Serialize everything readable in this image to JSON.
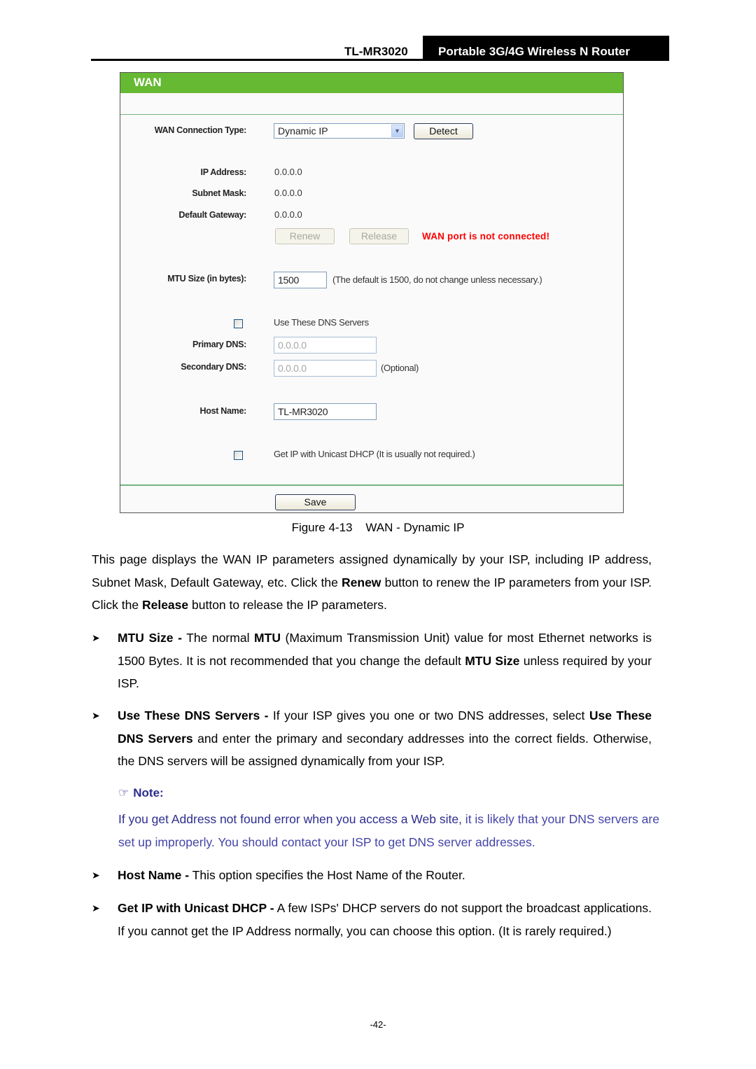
{
  "header": {
    "model": "TL-MR3020",
    "product": "Portable 3G/4G Wireless N Router"
  },
  "panel": {
    "title": "WAN",
    "connection_type": {
      "label": "WAN Connection Type:",
      "selected": "Dynamic IP",
      "detect_button": "Detect"
    },
    "ip_address": {
      "label": "IP Address:",
      "value": "0.0.0.0"
    },
    "subnet_mask": {
      "label": "Subnet Mask:",
      "value": "0.0.0.0"
    },
    "default_gateway": {
      "label": "Default Gateway:",
      "value": "0.0.0.0"
    },
    "renew_button": "Renew",
    "release_button": "Release",
    "status_message": "WAN port is not connected!",
    "status_color": "#ff0000",
    "mtu": {
      "label": "MTU Size (in bytes):",
      "value": "1500",
      "hint": "(The default is 1500, do not change unless necessary.)"
    },
    "use_dns": {
      "label": "Use These DNS Servers",
      "checked": false
    },
    "primary_dns": {
      "label": "Primary DNS:",
      "value": "0.0.0.0"
    },
    "secondary_dns": {
      "label": "Secondary DNS:",
      "value": "0.0.0.0",
      "hint": "(Optional)"
    },
    "host_name": {
      "label": "Host Name:",
      "value": "TL-MR3020"
    },
    "unicast_dhcp": {
      "label": "Get IP with Unicast DHCP (It is usually not required.)",
      "checked": false
    },
    "save_button": "Save",
    "accent_color": "#66b933"
  },
  "caption": "Figure 4-13    WAN - Dynamic IP",
  "intro": {
    "p1": "This page displays the WAN IP parameters assigned dynamically by your ISP, including IP address, Subnet Mask, Default Gateway, etc. Click the ",
    "b1": "Renew",
    "p2": " button to renew the IP parameters from your ISP. Click the ",
    "b2": "Release",
    "p3": " button to release the IP parameters."
  },
  "bullets": {
    "mtu": {
      "term": "MTU Size -",
      "t1": " The normal ",
      "b1": "MTU",
      "t2": " (Maximum Transmission Unit) value for most Ethernet networks is 1500 Bytes. It is not recommended that you change the default ",
      "b2": "MTU Size",
      "t3": " unless required by your ISP."
    },
    "dns": {
      "term": "Use These DNS Servers -",
      "t1": " If your ISP gives you one or two DNS addresses, select ",
      "b1": "Use These DNS Servers",
      "t2": " and enter the primary and secondary addresses into the correct fields. Otherwise, the DNS servers will be assigned dynamically from your ISP."
    },
    "host": {
      "term": "Host Name -",
      "t1": " This option specifies the Host Name of the Router."
    },
    "unicast": {
      "term": "Get IP with Unicast DHCP -",
      "t1": " A few ISPs' DHCP servers do not support the broadcast applications. If you cannot get the IP Address normally, you can choose this option. (It is rarely required.)"
    }
  },
  "note": {
    "icon": "pointing-hand-icon",
    "title": "Note:",
    "t1": "If you get Address not found error when you access a Web site,",
    "t2": " it is likely that your DNS servers are set up improperly. You should contact your ISP to get DNS server addresses."
  },
  "page_number": "-42-"
}
